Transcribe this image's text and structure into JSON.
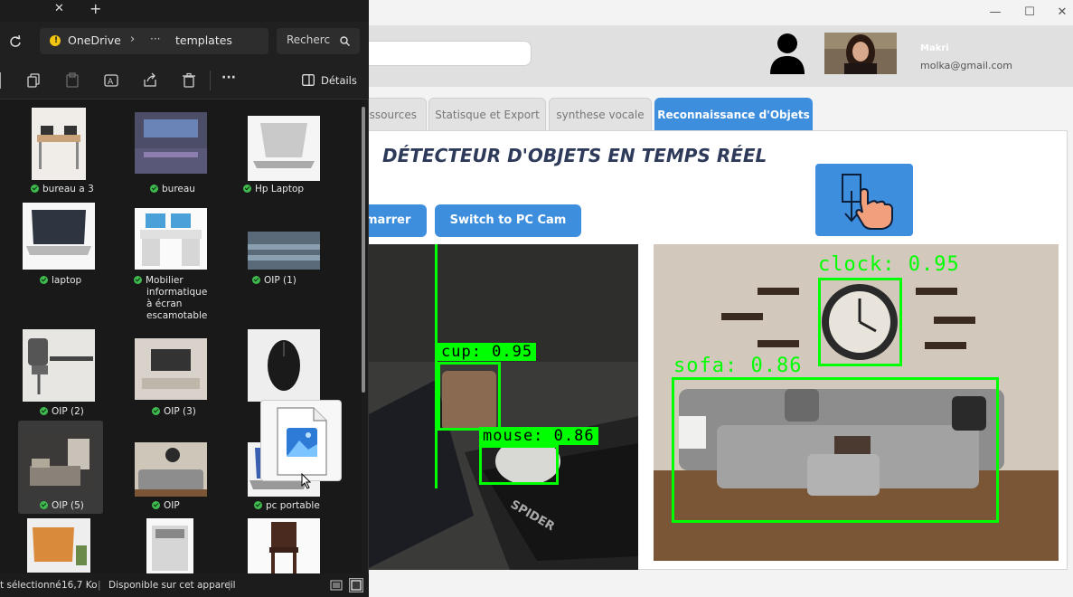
{
  "app": {
    "window_controls": [
      "—",
      "☐",
      "✕"
    ],
    "user": {
      "name": "Makri",
      "email": "molka@gmail.com"
    },
    "tabs": [
      {
        "label": "ssources"
      },
      {
        "label": "Statisque et Export"
      },
      {
        "label": "synthese vocale"
      },
      {
        "label": "Reconnaissance d'Objets"
      }
    ],
    "title": "DÉTECTEUR D'OBJETS EN TEMPS RÉEL",
    "buttons": {
      "start": "marrer",
      "switch": "Switch to PC Cam"
    },
    "detections_left": [
      {
        "label": "cup: 0.95"
      },
      {
        "label": "mouse: 0.86"
      }
    ],
    "detections_right": [
      {
        "label": "clock: 0.95"
      },
      {
        "label": "sofa: 0.86"
      }
    ],
    "cam_text": "SPIDER",
    "colors": {
      "accent": "#3e8ede",
      "detection": "#00ff00",
      "title": "#2e3a5a"
    }
  },
  "explorer": {
    "tab_close": "✕",
    "tab_add": "+",
    "refresh_icon": "refresh-icon",
    "breadcrumb": {
      "location": "OneDrive",
      "separator": "›",
      "more": "···",
      "folder": "templates"
    },
    "search_placeholder": "Recherc",
    "toolbar": {
      "more": "···",
      "details": "Détails"
    },
    "files": [
      {
        "label": "bureau a 3"
      },
      {
        "label": "bureau"
      },
      {
        "label": "Hp Laptop"
      },
      {
        "label": "laptop"
      },
      {
        "label": "Mobilier informatique à écran escamotable"
      },
      {
        "label": "OIP (1)"
      },
      {
        "label": "OIP (2)"
      },
      {
        "label": "OIP (3)"
      },
      {
        "label": ""
      },
      {
        "label": "OIP (5)"
      },
      {
        "label": "OIP"
      },
      {
        "label": "pc portable"
      },
      {
        "label": ""
      },
      {
        "label": ""
      },
      {
        "label": ""
      }
    ],
    "status": {
      "selected": "t sélectionné",
      "size": "16,7 Ko",
      "availability": "Disponible sur cet appareil"
    }
  }
}
